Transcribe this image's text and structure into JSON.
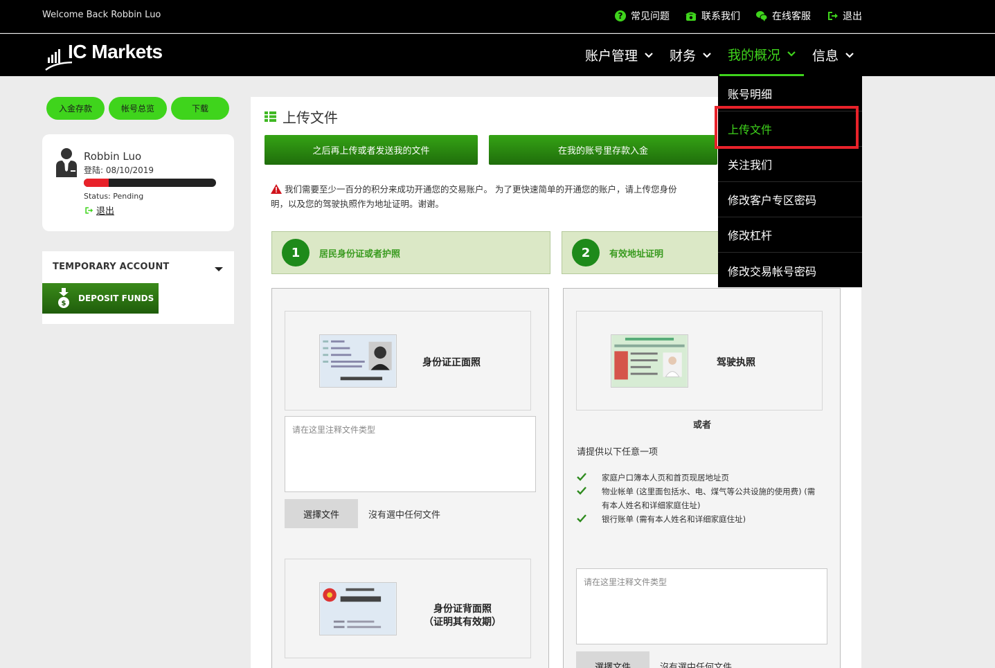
{
  "topbar": {
    "welcome": "Welcome Back Robbin Luo",
    "links": [
      {
        "icon": "question-icon",
        "label": "常见问题"
      },
      {
        "icon": "phone-icon",
        "label": "联系我们"
      },
      {
        "icon": "chat-icon",
        "label": "在线客服"
      },
      {
        "icon": "logout-icon",
        "label": "退出"
      }
    ]
  },
  "brand": {
    "name": "IC Markets",
    "accent": "#3fd41c"
  },
  "nav": {
    "items": [
      {
        "label": "账户管理",
        "active": false
      },
      {
        "label": "财务",
        "active": false
      },
      {
        "label": "我的概况",
        "active": true
      },
      {
        "label": "信息",
        "active": false
      }
    ],
    "dropdown": [
      "账号明细",
      "上传文件",
      "关注我们",
      "修改客户专区密码",
      "修改杠杆",
      "修改交易帐号密码"
    ],
    "dropdown_active": "上传文件"
  },
  "sidebar": {
    "buttons": [
      "入金存款",
      "帐号总览",
      "下载"
    ],
    "profile": {
      "name": "Robbin Luo",
      "login": "登陆: 08/10/2019",
      "progress": 0.19,
      "status": "Status: Pending",
      "logout": "退出"
    },
    "temp_account": {
      "title": "TEMPORARY ACCOUNT",
      "deposit": "DEPOSIT FUNDS"
    }
  },
  "main": {
    "title": "上传文件",
    "btn_later": "之后再上传或者发送我的文件",
    "btn_deposit": "在我的账号里存款入金",
    "notice": "我们需要至少一百分的积分来成功开通您的交易账户。 为了更快速简单的开通您的账户，请上传您身份证明，以及您的驾驶执照作为地址证明。谢谢。",
    "notice_visible_l1": "我们需要至少一百分的积分来成功开通您的交易账户。 为了更快速简单的开通您的账户，请上传您身份",
    "notice_visible_l2": "明，以及您的驾驶执照作为地址证明。谢谢。",
    "steps": [
      {
        "num": "1",
        "label": "居民身份证或者护照"
      },
      {
        "num": "2",
        "label": "有效地址证明"
      }
    ],
    "col1": {
      "card1": "身份证正面照",
      "card2_l1": "身份证背面照",
      "card2_l2": "（证明其有效期）",
      "placeholder": "请在这里注释文件类型",
      "choose": "選擇文件",
      "nofile": "沒有選中任何文件"
    },
    "col2": {
      "card1": "驾驶执照",
      "or": "或者",
      "provide": "请提供以下任意一项",
      "items": [
        "家庭户口簿本人页和首页现居地址页",
        "物业帐单 (这里面包括水、电、煤气等公共设施的使用费) (需有本人姓名和详细家庭住址)",
        "银行账单 (需有本人姓名和详细家庭住址)"
      ],
      "placeholder": "请在这里注释文件类型",
      "choose": "選擇文件",
      "nofile": "沒有選中任何文件"
    }
  }
}
